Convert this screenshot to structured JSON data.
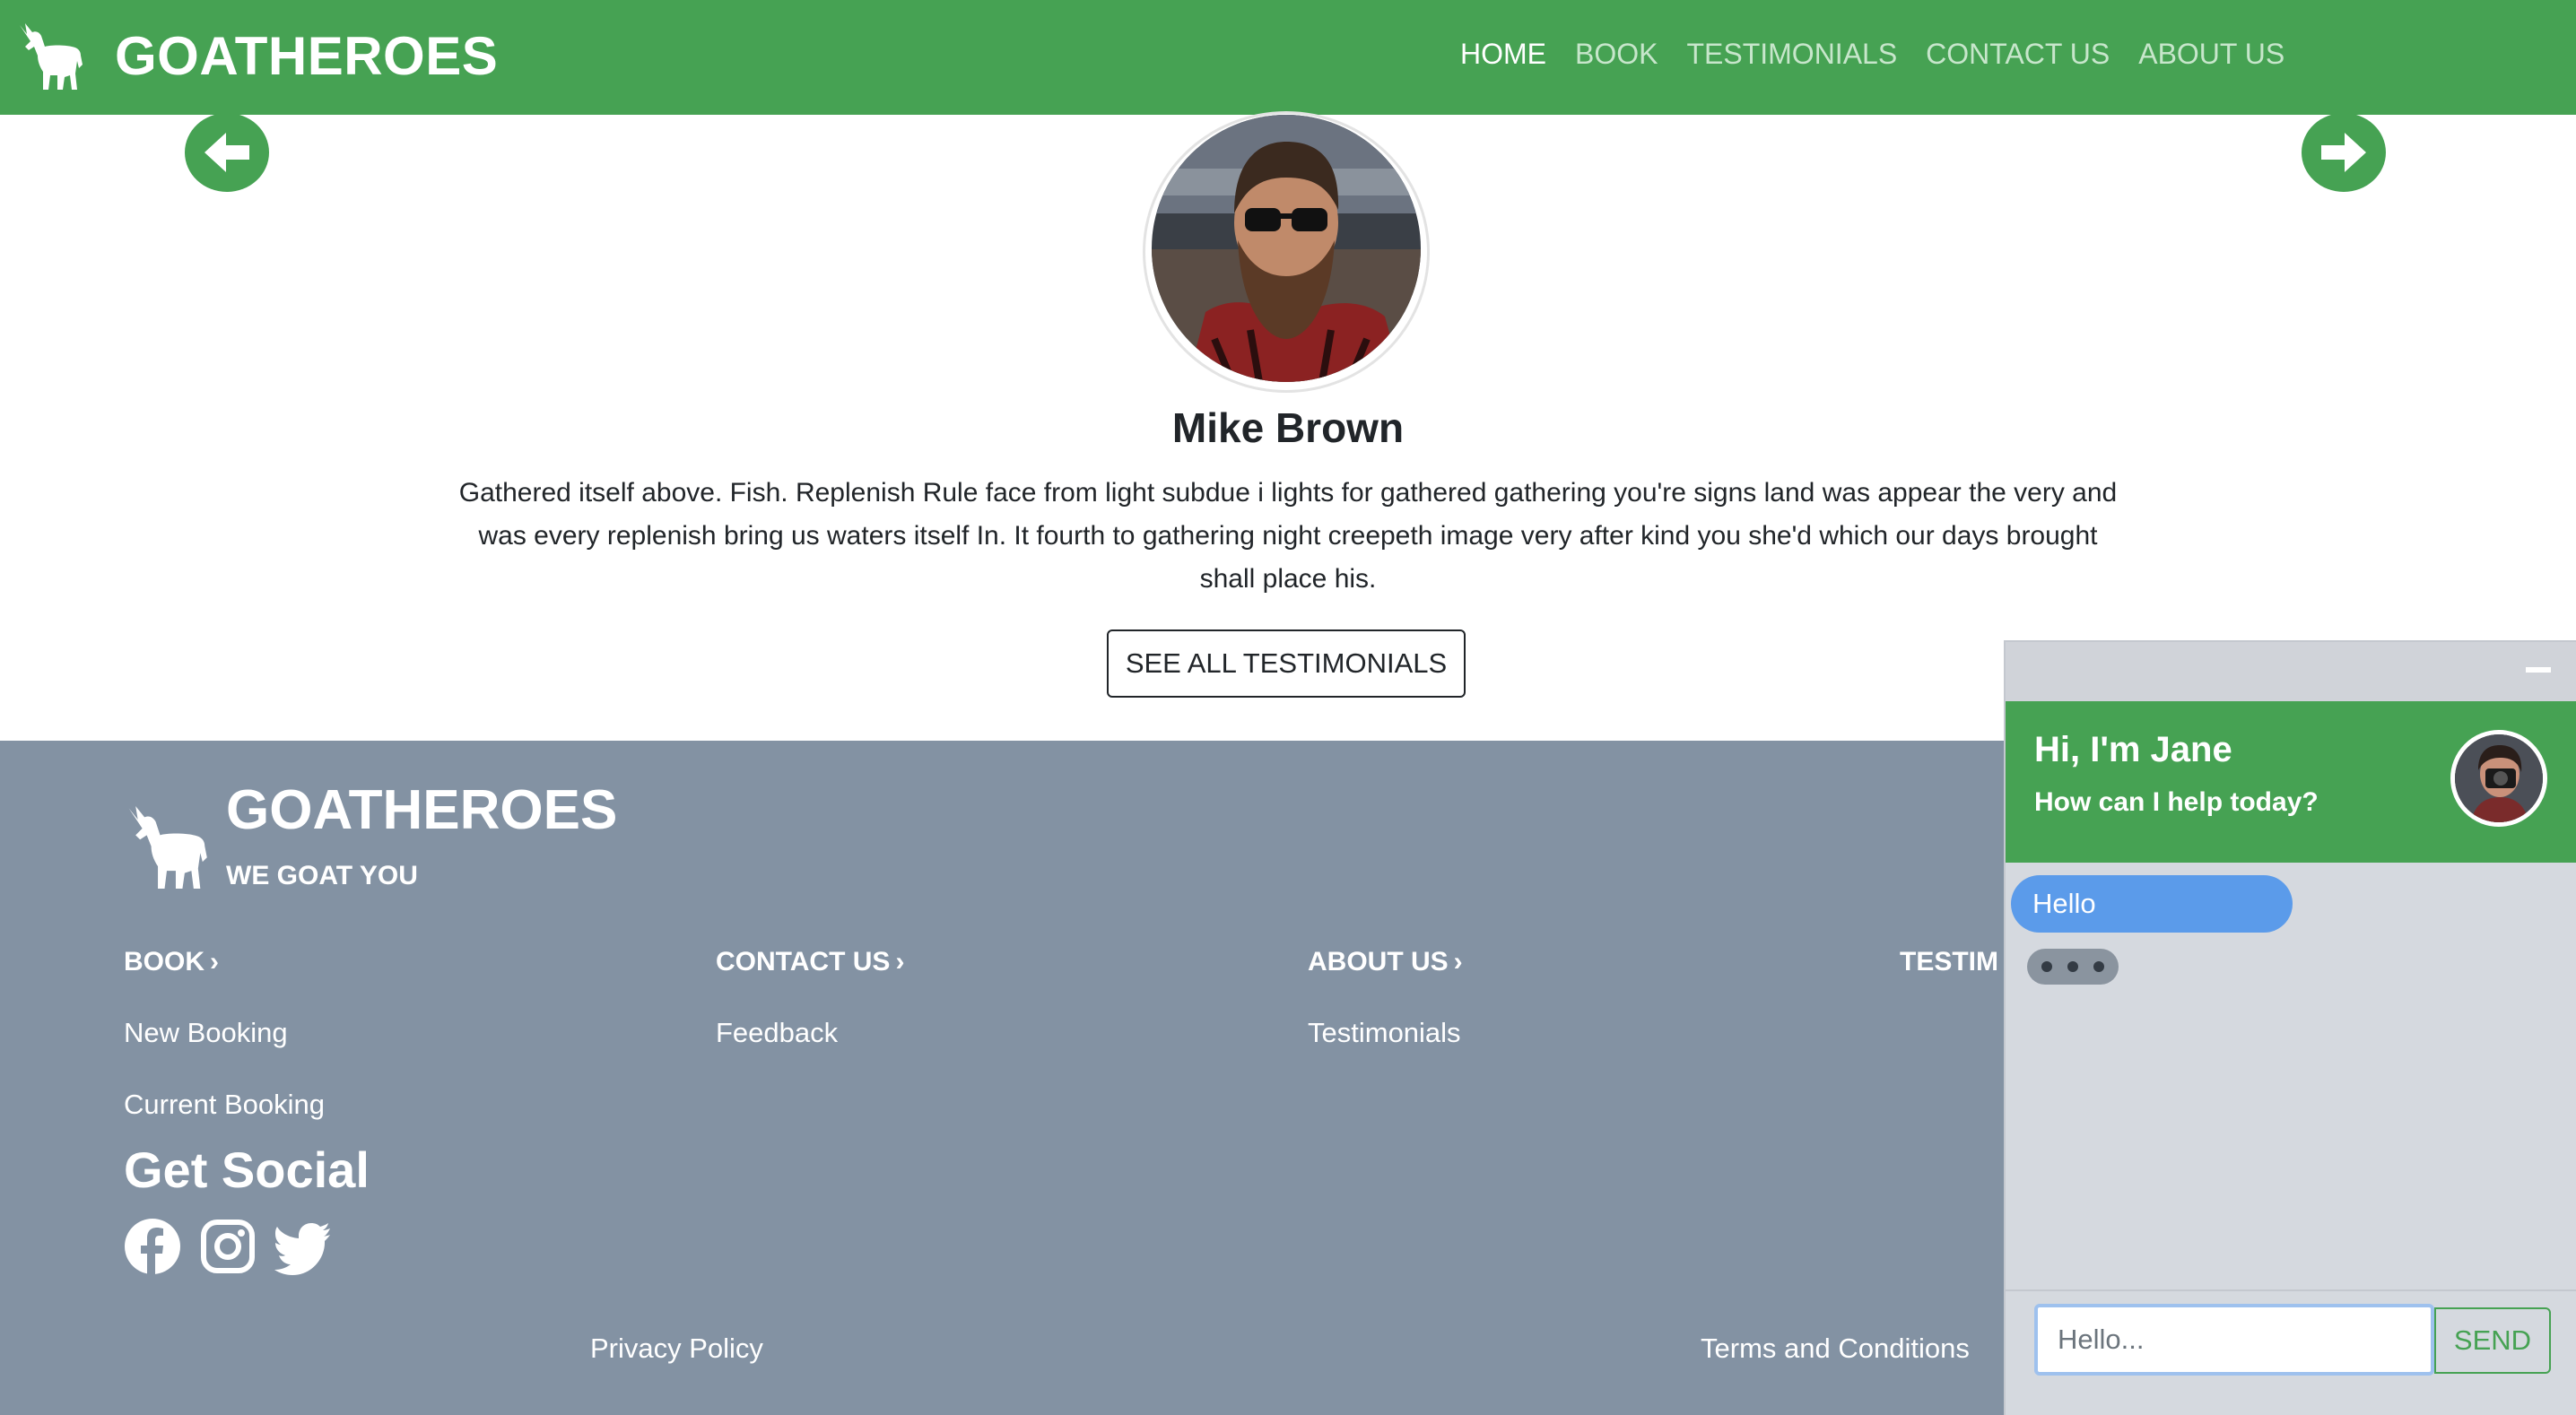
{
  "brand": {
    "name": "GOATHEROES",
    "tagline": "WE GOAT YOU",
    "logo_icon": "goat-icon"
  },
  "nav": {
    "items": [
      {
        "label": "HOME",
        "active": true
      },
      {
        "label": "BOOK",
        "active": false
      },
      {
        "label": "TESTIMONIALS",
        "active": false
      },
      {
        "label": "CONTACT US",
        "active": false
      },
      {
        "label": "ABOUT US",
        "active": false
      }
    ]
  },
  "carousel": {
    "prev_icon": "arrow-left-icon",
    "next_icon": "arrow-right-icon"
  },
  "testimonial": {
    "name": "Mike Brown",
    "text": "Gathered itself above. Fish. Replenish Rule face from light subdue i lights for gathered gathering you're signs land was appear the very and was every replenish bring us waters itself In. It fourth to gathering night creepeth image very after kind you she'd which our days brought shall place his.",
    "button": "SEE ALL TESTIMONIALS"
  },
  "footer": {
    "columns": [
      {
        "heading": "BOOK",
        "links": [
          "New Booking",
          "Current Booking"
        ]
      },
      {
        "heading": "CONTACT US",
        "links": [
          "Feedback"
        ]
      },
      {
        "heading": "ABOUT US",
        "links": [
          "Testimonials"
        ]
      },
      {
        "heading": "TESTIM"
      }
    ],
    "social_title": "Get Social",
    "social_icons": [
      "facebook-icon",
      "instagram-icon",
      "twitter-icon"
    ],
    "legal": {
      "privacy": "Privacy Policy",
      "terms": "Terms and Conditions"
    }
  },
  "chat": {
    "title": "Hi, I'm Jane",
    "subtitle": "How can I help today?",
    "messages": [
      {
        "from": "user",
        "text": "Hello"
      }
    ],
    "input_placeholder": "Hello...",
    "send_label": "SEND"
  },
  "colors": {
    "primary": "#46a253",
    "footer": "#8392a3",
    "chat_bg": "#d5d9df",
    "user_bubble": "#5b9bea"
  }
}
